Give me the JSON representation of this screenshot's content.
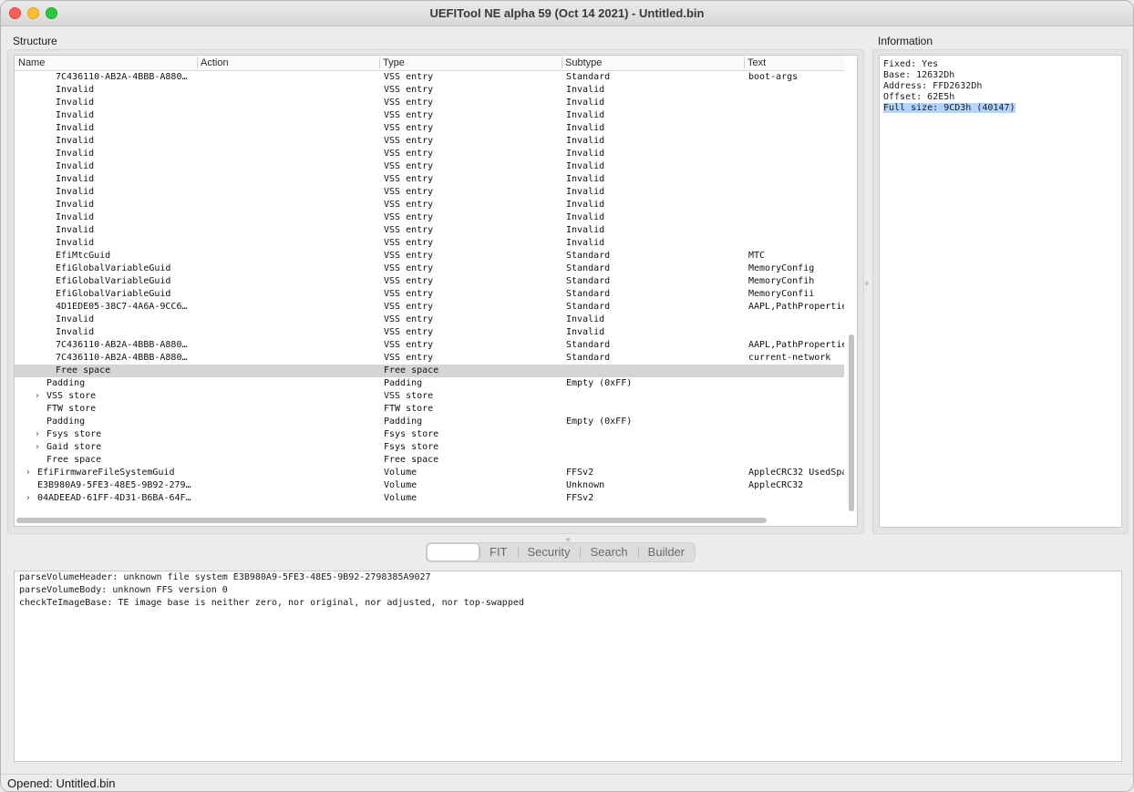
{
  "window": {
    "title": "UEFITool NE alpha 59 (Oct 14 2021) - Untitled.bin"
  },
  "structure": {
    "label": "Structure",
    "columns": [
      "Name",
      "Action",
      "Type",
      "Subtype",
      "Text"
    ],
    "rows": [
      {
        "name": "7C436110-AB2A-4BBB-A880…",
        "indent": 3,
        "expander": "",
        "type": "VSS entry",
        "subtype": "Standard",
        "text": "boot-args",
        "selected": false
      },
      {
        "name": "Invalid",
        "indent": 3,
        "expander": "",
        "type": "VSS entry",
        "subtype": "Invalid",
        "text": "",
        "selected": false
      },
      {
        "name": "Invalid",
        "indent": 3,
        "expander": "",
        "type": "VSS entry",
        "subtype": "Invalid",
        "text": "",
        "selected": false
      },
      {
        "name": "Invalid",
        "indent": 3,
        "expander": "",
        "type": "VSS entry",
        "subtype": "Invalid",
        "text": "",
        "selected": false
      },
      {
        "name": "Invalid",
        "indent": 3,
        "expander": "",
        "type": "VSS entry",
        "subtype": "Invalid",
        "text": "",
        "selected": false
      },
      {
        "name": "Invalid",
        "indent": 3,
        "expander": "",
        "type": "VSS entry",
        "subtype": "Invalid",
        "text": "",
        "selected": false
      },
      {
        "name": "Invalid",
        "indent": 3,
        "expander": "",
        "type": "VSS entry",
        "subtype": "Invalid",
        "text": "",
        "selected": false
      },
      {
        "name": "Invalid",
        "indent": 3,
        "expander": "",
        "type": "VSS entry",
        "subtype": "Invalid",
        "text": "",
        "selected": false
      },
      {
        "name": "Invalid",
        "indent": 3,
        "expander": "",
        "type": "VSS entry",
        "subtype": "Invalid",
        "text": "",
        "selected": false
      },
      {
        "name": "Invalid",
        "indent": 3,
        "expander": "",
        "type": "VSS entry",
        "subtype": "Invalid",
        "text": "",
        "selected": false
      },
      {
        "name": "Invalid",
        "indent": 3,
        "expander": "",
        "type": "VSS entry",
        "subtype": "Invalid",
        "text": "",
        "selected": false
      },
      {
        "name": "Invalid",
        "indent": 3,
        "expander": "",
        "type": "VSS entry",
        "subtype": "Invalid",
        "text": "",
        "selected": false
      },
      {
        "name": "Invalid",
        "indent": 3,
        "expander": "",
        "type": "VSS entry",
        "subtype": "Invalid",
        "text": "",
        "selected": false
      },
      {
        "name": "Invalid",
        "indent": 3,
        "expander": "",
        "type": "VSS entry",
        "subtype": "Invalid",
        "text": "",
        "selected": false
      },
      {
        "name": "EfiMtcGuid",
        "indent": 3,
        "expander": "",
        "type": "VSS entry",
        "subtype": "Standard",
        "text": "MTC",
        "selected": false
      },
      {
        "name": "EfiGlobalVariableGuid",
        "indent": 3,
        "expander": "",
        "type": "VSS entry",
        "subtype": "Standard",
        "text": "MemoryConfig",
        "selected": false
      },
      {
        "name": "EfiGlobalVariableGuid",
        "indent": 3,
        "expander": "",
        "type": "VSS entry",
        "subtype": "Standard",
        "text": "MemoryConfih",
        "selected": false
      },
      {
        "name": "EfiGlobalVariableGuid",
        "indent": 3,
        "expander": "",
        "type": "VSS entry",
        "subtype": "Standard",
        "text": "MemoryConfii",
        "selected": false
      },
      {
        "name": "4D1EDE05-38C7-4A6A-9CC6…",
        "indent": 3,
        "expander": "",
        "type": "VSS entry",
        "subtype": "Standard",
        "text": "AAPL,PathPropertie",
        "selected": false
      },
      {
        "name": "Invalid",
        "indent": 3,
        "expander": "",
        "type": "VSS entry",
        "subtype": "Invalid",
        "text": "",
        "selected": false
      },
      {
        "name": "Invalid",
        "indent": 3,
        "expander": "",
        "type": "VSS entry",
        "subtype": "Invalid",
        "text": "",
        "selected": false
      },
      {
        "name": "7C436110-AB2A-4BBB-A880…",
        "indent": 3,
        "expander": "",
        "type": "VSS entry",
        "subtype": "Standard",
        "text": "AAPL,PathPropertie",
        "selected": false
      },
      {
        "name": "7C436110-AB2A-4BBB-A880…",
        "indent": 3,
        "expander": "",
        "type": "VSS entry",
        "subtype": "Standard",
        "text": "current-network",
        "selected": false
      },
      {
        "name": "Free space",
        "indent": 3,
        "expander": "",
        "type": "Free space",
        "subtype": "",
        "text": "",
        "selected": true
      },
      {
        "name": "Padding",
        "indent": 2,
        "expander": "",
        "type": "Padding",
        "subtype": "Empty (0xFF)",
        "text": "",
        "selected": false
      },
      {
        "name": "VSS store",
        "indent": 2,
        "expander": ">",
        "type": "VSS store",
        "subtype": "",
        "text": "",
        "selected": false
      },
      {
        "name": "FTW store",
        "indent": 2,
        "expander": "",
        "type": "FTW store",
        "subtype": "",
        "text": "",
        "selected": false
      },
      {
        "name": "Padding",
        "indent": 2,
        "expander": "",
        "type": "Padding",
        "subtype": "Empty (0xFF)",
        "text": "",
        "selected": false
      },
      {
        "name": "Fsys store",
        "indent": 2,
        "expander": ">",
        "type": "Fsys store",
        "subtype": "",
        "text": "",
        "selected": false
      },
      {
        "name": "Gaid store",
        "indent": 2,
        "expander": ">",
        "type": "Fsys store",
        "subtype": "",
        "text": "",
        "selected": false
      },
      {
        "name": "Free space",
        "indent": 2,
        "expander": "",
        "type": "Free space",
        "subtype": "",
        "text": "",
        "selected": false
      },
      {
        "name": "EfiFirmwareFileSystemGuid",
        "indent": 1,
        "expander": ">",
        "type": "Volume",
        "subtype": "FFSv2",
        "text": "AppleCRC32 UsedSpa",
        "selected": false
      },
      {
        "name": "E3B980A9-5FE3-48E5-9B92-279…",
        "indent": 1,
        "expander": "",
        "type": "Volume",
        "subtype": "Unknown",
        "text": "AppleCRC32",
        "selected": false
      },
      {
        "name": "04ADEEAD-61FF-4D31-B6BA-64F…",
        "indent": 1,
        "expander": ">",
        "type": "Volume",
        "subtype": "FFSv2",
        "text": "",
        "selected": false
      }
    ]
  },
  "information": {
    "label": "Information",
    "lines": [
      {
        "text": "Fixed: Yes",
        "highlight": false
      },
      {
        "text": "Base: 12632Dh",
        "highlight": false
      },
      {
        "text": "Address: FFD2632Dh",
        "highlight": false
      },
      {
        "text": "Offset: 62E5h",
        "highlight": false
      },
      {
        "text": "Full size: 9CD3h (40147)",
        "highlight": true
      }
    ]
  },
  "tabs": [
    {
      "label": "",
      "active": true
    },
    {
      "label": "FIT",
      "active": false
    },
    {
      "label": "Security",
      "active": false
    },
    {
      "label": "Search",
      "active": false
    },
    {
      "label": "Builder",
      "active": false
    }
  ],
  "log": [
    "parseVolumeHeader: unknown file system E3B980A9-5FE3-48E5-9B92-2798385A9027",
    "parseVolumeBody: unknown FFS version 0",
    "checkTeImageBase: TE image base is neither zero, nor original, nor adjusted, nor top-swapped"
  ],
  "status": {
    "text": "Opened: Untitled.bin"
  },
  "colors": {
    "selection": "#d4d4d4",
    "text_highlight": "#b3d4fc"
  }
}
